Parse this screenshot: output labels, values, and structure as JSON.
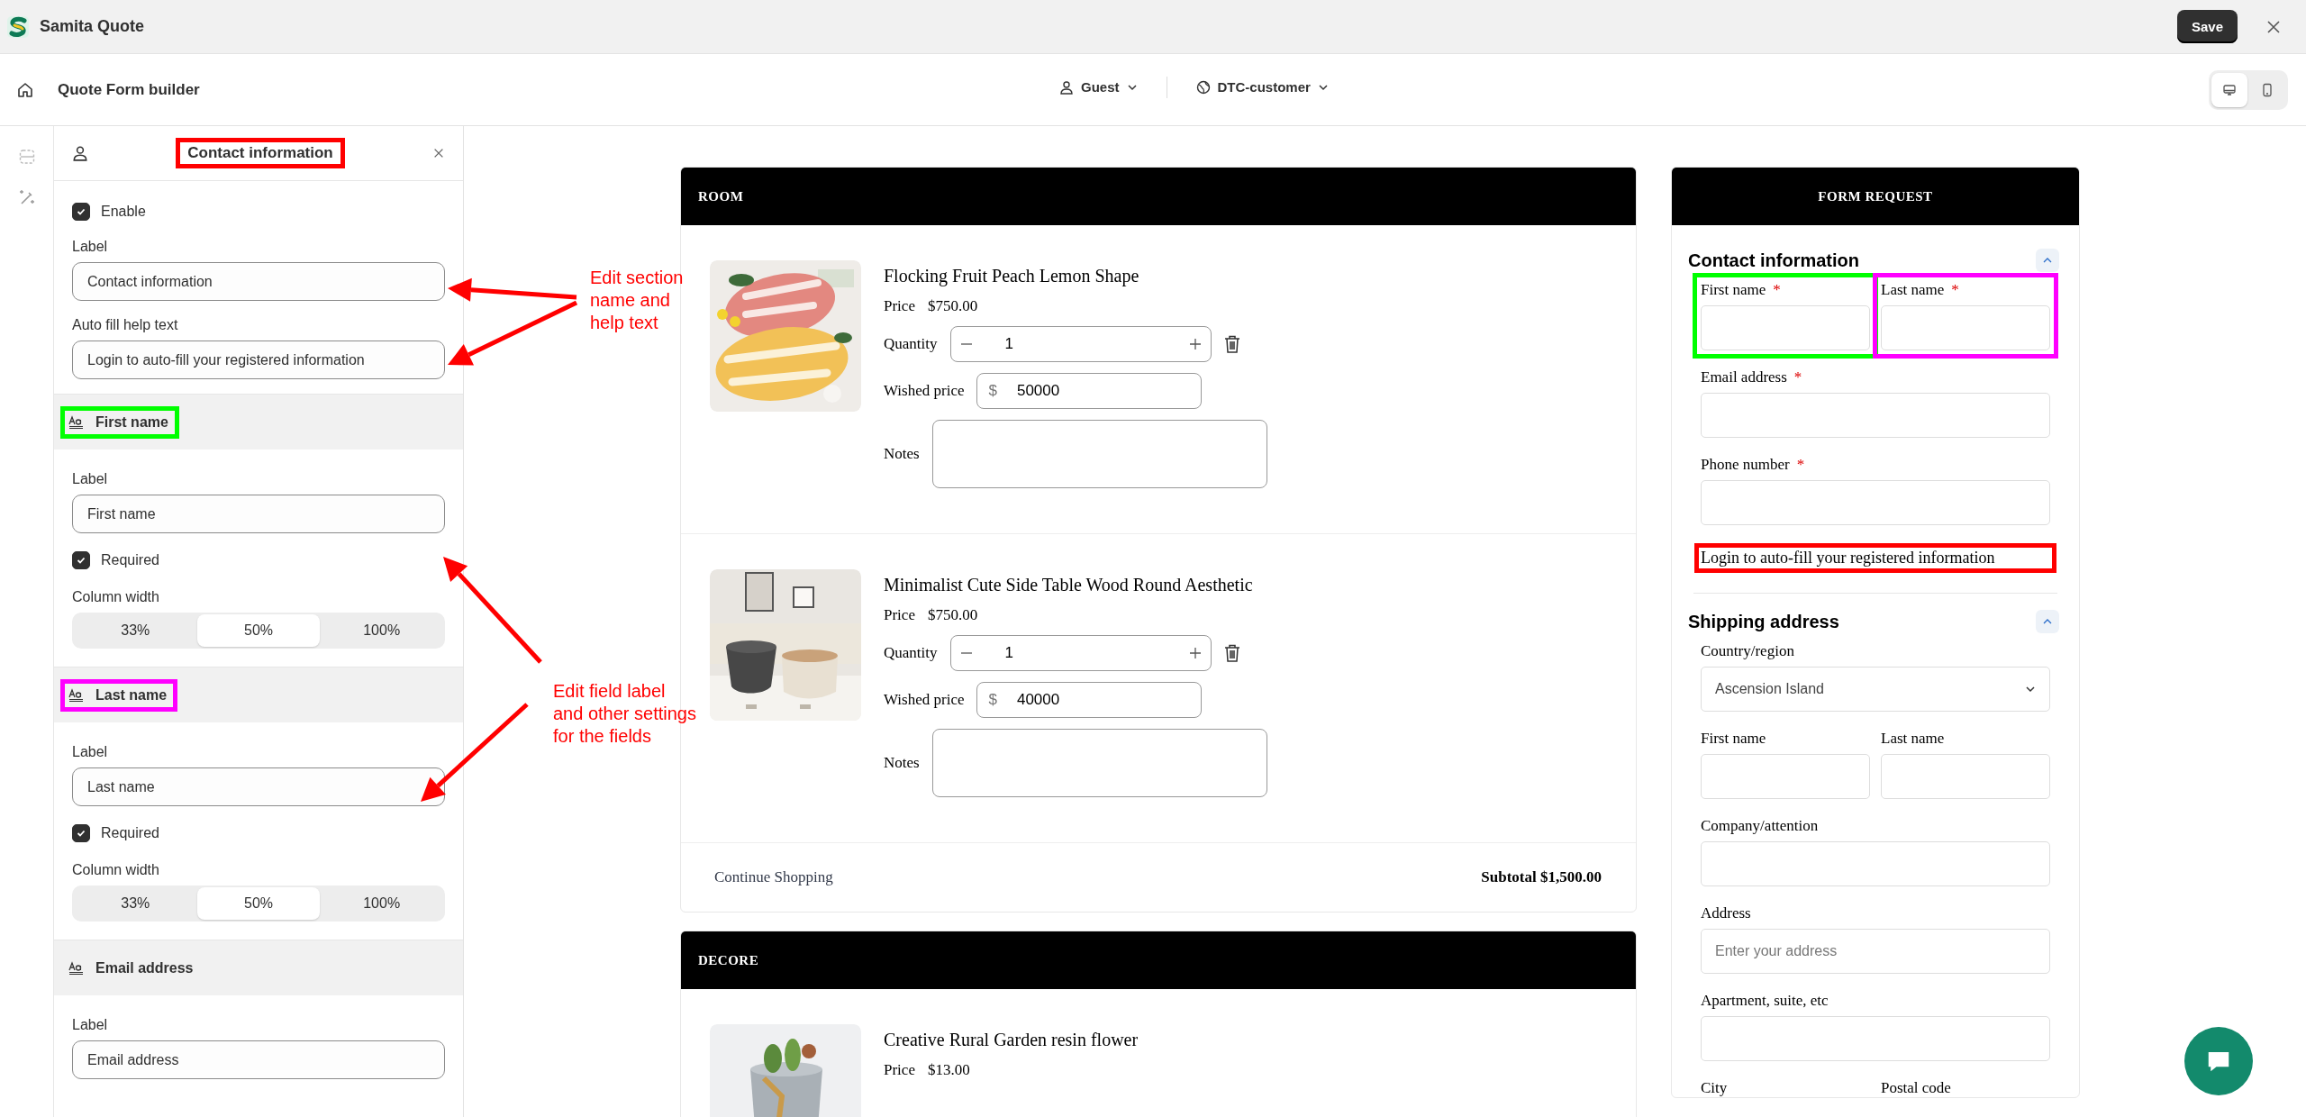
{
  "app_bar": {
    "title": "Samita Quote",
    "save_label": "Save"
  },
  "toolbar": {
    "title": "Quote Form builder",
    "audience": "Guest",
    "customer_group": "DTC-customer",
    "view_modes": [
      {
        "kind": "desktop",
        "selected": true
      },
      {
        "kind": "mobile",
        "selected": false
      }
    ]
  },
  "settings_panel": {
    "title": {
      "text": "Contact information",
      "color": "#ff0000"
    },
    "enable": {
      "label": "Enable",
      "checked": true
    },
    "fields": [
      {
        "label": "Label",
        "value": "Contact information"
      },
      {
        "label": "Auto fill help text",
        "value": "Login to auto-fill your registered information"
      }
    ],
    "sections": [
      {
        "title": "First name",
        "color": "#00ff00",
        "label_caption": "Label",
        "label_value": "First name",
        "required": {
          "label": "Required",
          "checked": true
        },
        "column_width": {
          "caption": "Column width",
          "options": [
            {
              "label": "33%",
              "selected": false
            },
            {
              "label": "50%",
              "selected": true
            },
            {
              "label": "100%",
              "selected": false
            }
          ]
        }
      },
      {
        "title": "Last name",
        "color": "#ff00ff",
        "label_caption": "Label",
        "label_value": "Last name",
        "required": {
          "label": "Required",
          "checked": true
        },
        "column_width": {
          "caption": "Column width",
          "options": [
            {
              "label": "33%",
              "selected": false
            },
            {
              "label": "50%",
              "selected": true
            },
            {
              "label": "100%",
              "selected": false
            }
          ]
        }
      },
      {
        "title": "Email address",
        "label_caption": "Label",
        "label_value": "Email address"
      }
    ]
  },
  "cart": {
    "groups": [
      {
        "title": "ROOM",
        "items": [
          {
            "name": "Flocking Fruit Peach Lemon Shape",
            "price_label": "Price",
            "price": "$750.00",
            "quantity_label": "Quantity",
            "quantity": "1",
            "wished_price_label": "Wished price",
            "currency": "$",
            "wished_price": "50000",
            "notes_label": "Notes"
          },
          {
            "name": "Minimalist Cute Side Table Wood Round Aesthetic",
            "price_label": "Price",
            "price": "$750.00",
            "quantity_label": "Quantity",
            "quantity": "1",
            "wished_price_label": "Wished price",
            "currency": "$",
            "wished_price": "40000",
            "notes_label": "Notes"
          }
        ],
        "footer": {
          "continue": "Continue Shopping",
          "subtotal": "Subtotal $1,500.00"
        }
      },
      {
        "title": "DECORE",
        "items": [
          {
            "name": "Creative Rural Garden resin flower",
            "price_label": "Price",
            "price": "$13.00"
          }
        ]
      }
    ]
  },
  "form": {
    "title": "FORM REQUEST",
    "sections": [
      {
        "title": "Contact information",
        "expanded": true,
        "fields": [
          {
            "kind": "text",
            "label": "First name",
            "required_mark": "*",
            "half": true,
            "color": "#00ff00"
          },
          {
            "kind": "text",
            "label": "Last name",
            "required_mark": "*",
            "half": true,
            "color": "#ff00ff"
          },
          {
            "kind": "text",
            "label": "Email address",
            "required_mark": "*",
            "half": false
          },
          {
            "kind": "text",
            "label": "Phone number",
            "required_mark": "*",
            "half": false
          }
        ],
        "help": {
          "text": "Login to auto-fill your registered information",
          "color": "#ff0000"
        }
      },
      {
        "title": "Shipping address",
        "expanded": true,
        "fields": [
          {
            "kind": "select",
            "label": "Country/region",
            "value": "Ascension Island",
            "half": false
          },
          {
            "kind": "text",
            "label": "First name",
            "half": true
          },
          {
            "kind": "text",
            "label": "Last name",
            "half": true
          },
          {
            "kind": "text",
            "label": "Company/attention",
            "half": false
          },
          {
            "kind": "text",
            "label": "Address",
            "placeholder": "Enter your address",
            "half": false
          },
          {
            "kind": "text",
            "label": "Apartment, suite, etc",
            "half": false
          },
          {
            "kind": "caption",
            "label": "City",
            "half": true
          },
          {
            "kind": "caption",
            "label": "Postal code",
            "half": true
          }
        ]
      }
    ]
  },
  "annotations": [
    {
      "text": "Edit section\nname and\nhelp text"
    },
    {
      "text": "Edit field label\nand other settings\nfor the fields"
    }
  ]
}
